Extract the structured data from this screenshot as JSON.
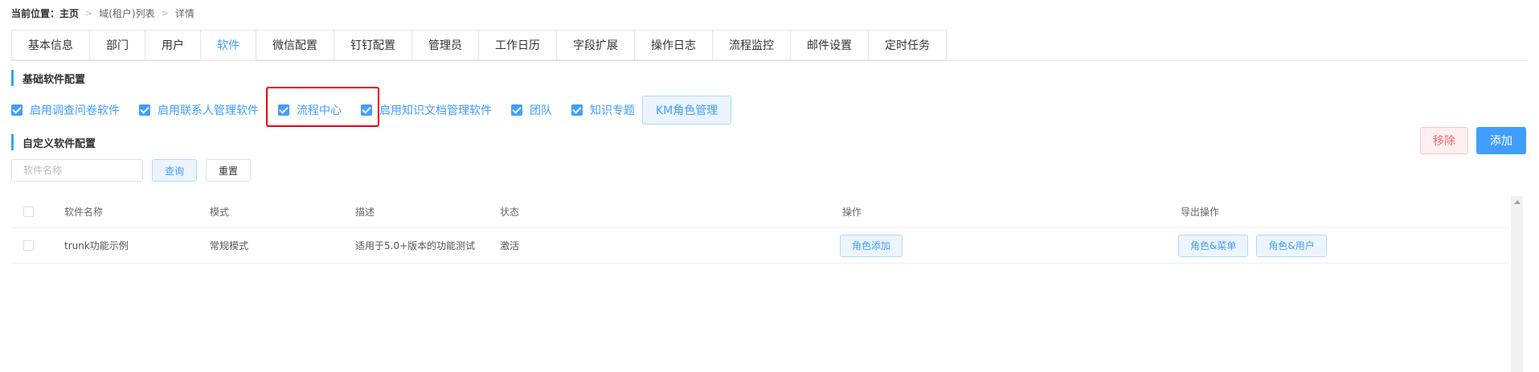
{
  "breadcrumb": {
    "label": "当前位置：",
    "items": [
      "主页",
      "域(租户)列表",
      "详情"
    ]
  },
  "tabs": [
    {
      "label": "基本信息",
      "active": false
    },
    {
      "label": "部门",
      "active": false
    },
    {
      "label": "用户",
      "active": false
    },
    {
      "label": "软件",
      "active": true
    },
    {
      "label": "微信配置",
      "active": false
    },
    {
      "label": "钉钉配置",
      "active": false
    },
    {
      "label": "管理员",
      "active": false
    },
    {
      "label": "工作日历",
      "active": false
    },
    {
      "label": "字段扩展",
      "active": false
    },
    {
      "label": "操作日志",
      "active": false
    },
    {
      "label": "流程监控",
      "active": false
    },
    {
      "label": "邮件设置",
      "active": false
    },
    {
      "label": "定时任务",
      "active": false
    }
  ],
  "basic_section": {
    "title": "基础软件配置",
    "checkboxes": [
      {
        "label": "启用调查问卷软件",
        "checked": true
      },
      {
        "label": "启用联系人管理软件",
        "checked": true
      },
      {
        "label": "流程中心",
        "checked": true
      },
      {
        "label": "启用知识文档管理软件",
        "checked": true
      },
      {
        "label": "团队",
        "checked": true
      },
      {
        "label": "知识专题",
        "checked": true
      }
    ],
    "km_role_button": "KM角色管理"
  },
  "custom_section": {
    "title": "自定义软件配置",
    "search_placeholder": "软件名称",
    "query_button": "查询",
    "reset_button": "重置",
    "remove_button": "移除",
    "add_button": "添加"
  },
  "table": {
    "headers": {
      "name": "软件名称",
      "mode": "模式",
      "desc": "描述",
      "status": "状态",
      "actions": "操作",
      "export": "导出操作"
    },
    "rows": [
      {
        "name": "trunk功能示例",
        "mode": "常规模式",
        "desc": "适用于5.0+版本的功能测试",
        "status": "激活",
        "action_button": "角色添加",
        "export_buttons": [
          "角色&菜单",
          "角色&用户"
        ]
      }
    ]
  },
  "colors": {
    "accent": "#409eff",
    "highlight_border": "#e60012",
    "danger": "#f56c6c"
  }
}
